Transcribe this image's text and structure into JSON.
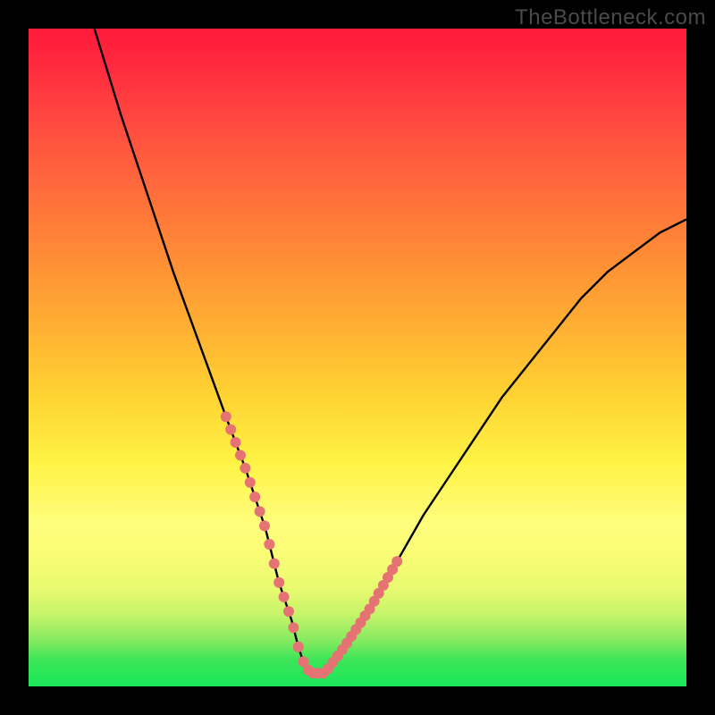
{
  "watermark": {
    "text": "TheBottleneck.com"
  },
  "chart_data": {
    "type": "line",
    "title": "",
    "xlabel": "",
    "ylabel": "",
    "xlim": [
      0,
      100
    ],
    "ylim": [
      0,
      100
    ],
    "series": [
      {
        "name": "bottleneck-curve",
        "x": [
          10,
          14,
          18,
          22,
          26,
          30,
          33,
          36,
          38,
          40,
          41,
          42,
          43,
          45,
          48,
          52,
          56,
          60,
          64,
          68,
          72,
          76,
          80,
          84,
          88,
          92,
          96,
          100
        ],
        "values": [
          100,
          87,
          75,
          63,
          52,
          41,
          33,
          24,
          16,
          10,
          6,
          3,
          2,
          2,
          6,
          12,
          19,
          26,
          32,
          38,
          44,
          49,
          54,
          59,
          63,
          66,
          69,
          71
        ]
      }
    ],
    "marker_segments": [
      {
        "name": "left-descending-dots",
        "x_range": [
          30,
          41
        ],
        "y_range": [
          6,
          41
        ]
      },
      {
        "name": "valley-dots",
        "x_range": [
          41,
          47
        ],
        "y_range": [
          2,
          6
        ]
      },
      {
        "name": "right-ascending-dots",
        "x_range": [
          47,
          56
        ],
        "y_range": [
          6,
          20
        ]
      }
    ],
    "colors": {
      "curve_stroke": "#000000",
      "marker_fill": "#e57373",
      "gradient_top": "#ff1a3a",
      "gradient_bottom": "#1ae65a"
    }
  }
}
